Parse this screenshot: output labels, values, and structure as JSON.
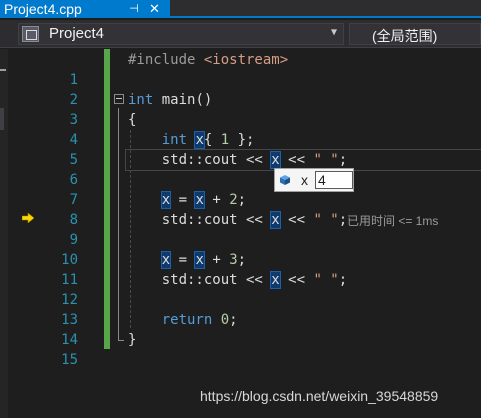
{
  "tab": {
    "title": "Project4.cpp",
    "pin": "⊣",
    "close": "✕"
  },
  "nav": {
    "project": "Project4",
    "scope": "(全局范围)"
  },
  "lines": [
    {
      "num": "1"
    },
    {
      "num": "2"
    },
    {
      "num": "3"
    },
    {
      "num": "4"
    },
    {
      "num": "5"
    },
    {
      "num": "6"
    },
    {
      "num": "7"
    },
    {
      "num": "8"
    },
    {
      "num": "9"
    },
    {
      "num": "10"
    },
    {
      "num": "11"
    },
    {
      "num": "12"
    },
    {
      "num": "13"
    },
    {
      "num": "14"
    },
    {
      "num": "15"
    }
  ],
  "code": {
    "l1_pre": "#include ",
    "l1_inc": "<iostream>",
    "l3_kw": "int",
    "l3_rest": " main()",
    "l4": "{",
    "l5_kw": "int",
    "l5_var": "x",
    "l5_brace1": "{ ",
    "l5_num": "1",
    "l5_end": " };",
    "cout_a": "std::cout << ",
    "cout_var": "x",
    "cout_b": " << ",
    "cout_str": "\" \"",
    "cout_end": ";",
    "assign_var": "x",
    "assign_eq": " = ",
    "assign_var2": "x",
    "plus": " + ",
    "l8_num": "2",
    "l11_num": "3",
    "semicolon": ";",
    "l14_kw": "return",
    "l14_num": "0",
    "l14_end": ";",
    "l15": "}",
    "space": " "
  },
  "perf_tip": "已用时间 <= 1ms",
  "datatip": {
    "name": "x",
    "value": "4"
  },
  "watermark": "https://blog.csdn.net/weixin_39548859",
  "colors": {
    "accent": "#007acc",
    "change_bar": "#57a64a",
    "line_number": "#2b91af",
    "keyword": "#569cd6"
  }
}
